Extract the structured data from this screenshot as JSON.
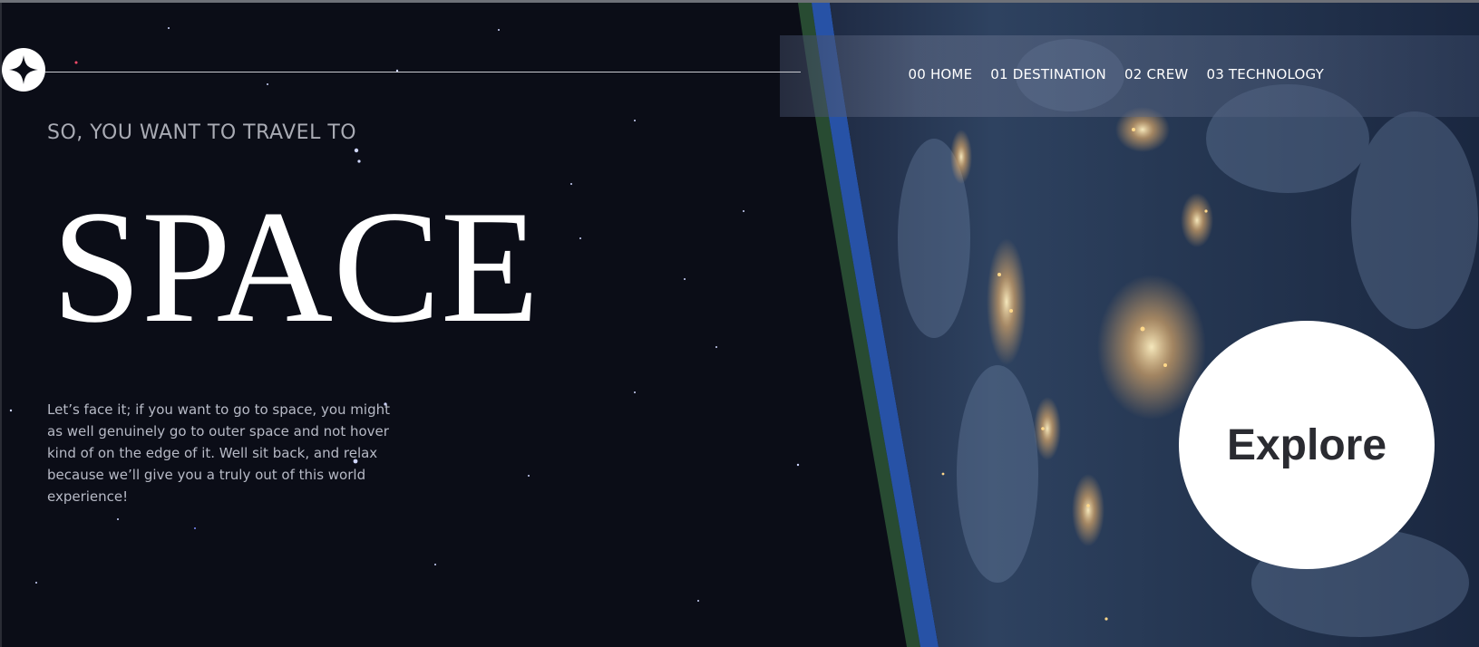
{
  "nav": {
    "links": [
      "00 HOME",
      "01 DESTINATION",
      "02 CREW",
      "03 TECHNOLOGY"
    ]
  },
  "hero": {
    "subtitle": "SO, YOU WANT TO TRAVEL TO",
    "title": "SPACE",
    "description": "Let’s face it; if you want to go to space, you might as well genuinely go to outer space and not hover kind of on the edge of it. Well sit back, and relax because we’ll give you a truly out of this world experience!",
    "explore_label": "Explore"
  },
  "icons": {
    "logo": "four-point-star-icon"
  },
  "colors": {
    "background": "#0b0d17",
    "text_light": "#ffffff",
    "text_muted": "#a9abb4"
  }
}
